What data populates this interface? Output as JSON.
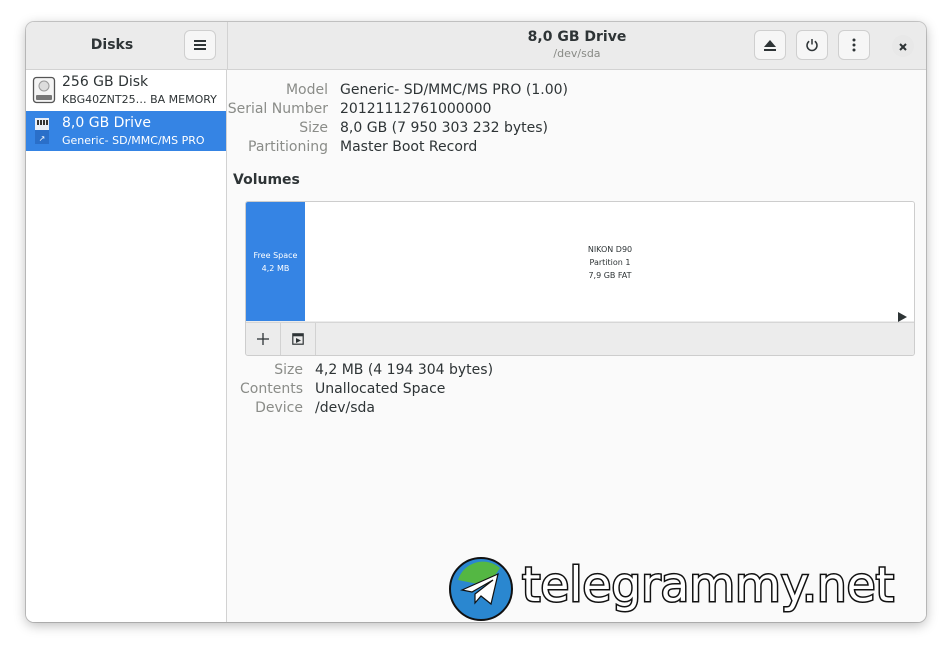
{
  "app": {
    "title": "Disks",
    "drive_title": "8,0 GB Drive",
    "drive_subtitle": "/dev/sda"
  },
  "sidebar": {
    "disks": [
      {
        "name": "256 GB Disk",
        "subtitle": "KBG40ZNT25… BA MEMORY",
        "icon": "hard-disk-icon",
        "selected": false
      },
      {
        "name": "8,0 GB Drive",
        "subtitle": "Generic- SD/MMC/MS PRO",
        "icon": "sd-card-icon",
        "selected": true
      }
    ]
  },
  "drive_info": {
    "model_label": "Model",
    "model_value": "Generic- SD/MMC/MS PRO (1.00)",
    "serial_label": "Serial Number",
    "serial_value": "20121112761000000",
    "size_label": "Size",
    "size_value": "8,0 GB (7 950 303 232 bytes)",
    "partitioning_label": "Partitioning",
    "partitioning_value": "Master Boot Record"
  },
  "volumes": {
    "label": "Volumes",
    "free_space": {
      "line1": "Free Space",
      "line2": "4,2 MB"
    },
    "partition": {
      "line1": "NIKON D90",
      "line2": "Partition 1",
      "line3": "7,9 GB FAT"
    }
  },
  "selected_volume": {
    "size_label": "Size",
    "size_value": "4,2 MB (4 194 304 bytes)",
    "contents_label": "Contents",
    "contents_value": "Unallocated Space",
    "device_label": "Device",
    "device_value": "/dev/sda"
  },
  "watermark": {
    "text": "telegrammy.net"
  },
  "colors": {
    "accent": "#3584e4",
    "header_bg": "#ebebeb",
    "content_bg": "#fafafa"
  }
}
